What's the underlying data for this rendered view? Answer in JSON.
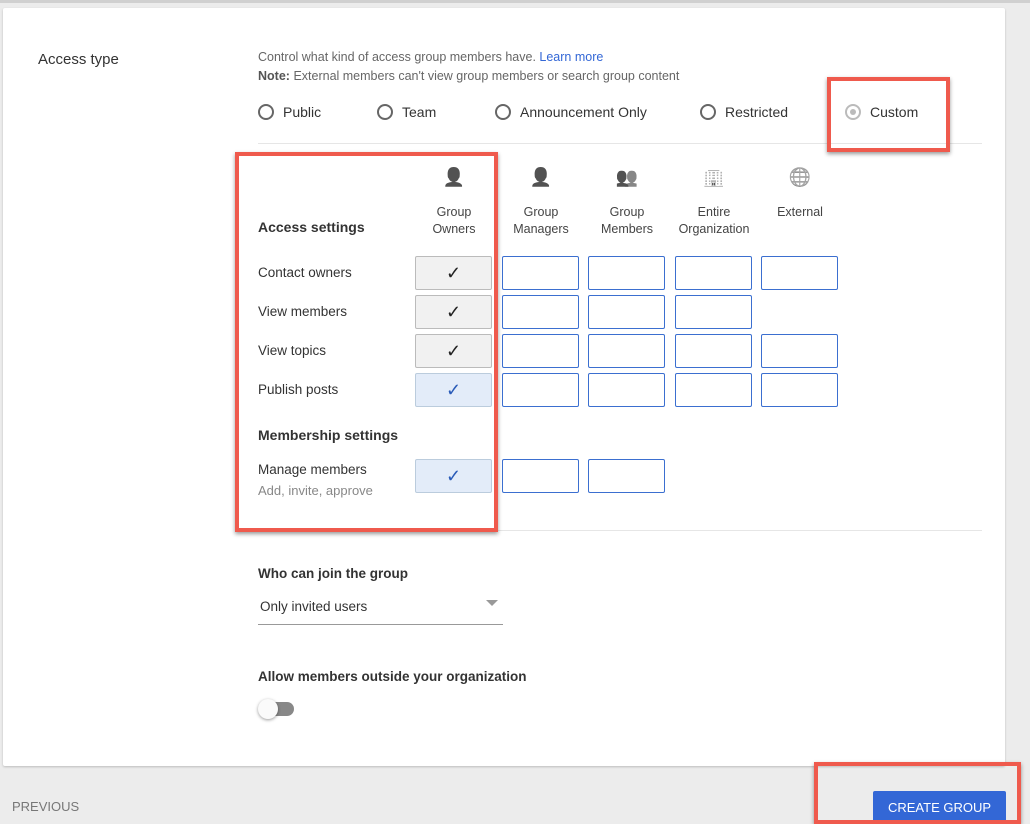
{
  "access_type": {
    "label": "Access type",
    "description": "Control what kind of access group members have.",
    "learn_more": "Learn more",
    "note_bold": "Note:",
    "note_text": "External members can't view group members or search group content",
    "options": [
      {
        "label": "Public",
        "selected": false
      },
      {
        "label": "Team",
        "selected": false
      },
      {
        "label": "Announcement Only",
        "selected": false
      },
      {
        "label": "Restricted",
        "selected": false
      },
      {
        "label": "Custom",
        "selected": true
      }
    ]
  },
  "columns": [
    {
      "icon": "person-outline-icon",
      "glyph": "👤",
      "label_1": "Group",
      "label_2": "Owners"
    },
    {
      "icon": "person-icon",
      "glyph": "👤",
      "label_1": "Group",
      "label_2": "Managers"
    },
    {
      "icon": "people-icon",
      "glyph": "👥",
      "label_1": "Group",
      "label_2": "Members"
    },
    {
      "icon": "building-icon",
      "glyph": "🏢",
      "label_1": "Entire",
      "label_2": "Organization"
    },
    {
      "icon": "globe-icon",
      "glyph": "🌐",
      "label_1": "External",
      "label_2": ""
    }
  ],
  "access_settings": {
    "title": "Access settings",
    "rows": [
      {
        "label": "Contact owners",
        "cells": [
          "checked",
          "empty",
          "empty",
          "empty",
          "empty"
        ]
      },
      {
        "label": "View members",
        "cells": [
          "checked",
          "empty",
          "empty",
          "empty",
          null
        ]
      },
      {
        "label": "View topics",
        "cells": [
          "checked",
          "empty",
          "empty",
          "empty",
          "empty"
        ]
      },
      {
        "label": "Publish posts",
        "cells": [
          "checked-blue",
          "empty",
          "empty",
          "empty",
          "empty"
        ]
      }
    ]
  },
  "membership_settings": {
    "title": "Membership settings",
    "rows": [
      {
        "label": "Manage members",
        "sublabel": "Add, invite, approve",
        "cells": [
          "checked-blue",
          "empty",
          "empty",
          null,
          null
        ]
      }
    ]
  },
  "join": {
    "label": "Who can join the group",
    "value": "Only invited users"
  },
  "outside": {
    "label": "Allow members outside your organization",
    "enabled": false
  },
  "footer": {
    "previous": "PREVIOUS",
    "create": "CREATE GROUP"
  },
  "colors": {
    "accent": "#3367d6",
    "highlight": "#ef5a4d"
  }
}
